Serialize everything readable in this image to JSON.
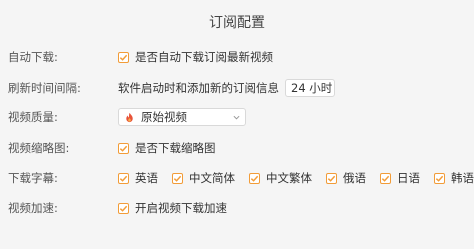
{
  "title": "订阅配置",
  "rows": {
    "auto_download": {
      "label": "自动下载:",
      "option": "是否自动下载订阅最新视频"
    },
    "refresh": {
      "label": "刷新时间间隔:",
      "desc": "软件启动时和添加新的订阅信息",
      "value": "24 小时"
    },
    "quality": {
      "label": "视频质量:",
      "value": "原始视频"
    },
    "thumbnail": {
      "label": "视频缩略图:",
      "option": "是否下载缩略图"
    },
    "subtitles": {
      "label": "下载字幕:",
      "options": [
        "英语",
        "中文简体",
        "中文繁体",
        "俄语",
        "日语",
        "韩语"
      ]
    },
    "acceleration": {
      "label": "视频加速:",
      "option": "开启视频下载加速"
    }
  },
  "colors": {
    "accent": "#f29c38",
    "background": "#f5f5f5"
  }
}
